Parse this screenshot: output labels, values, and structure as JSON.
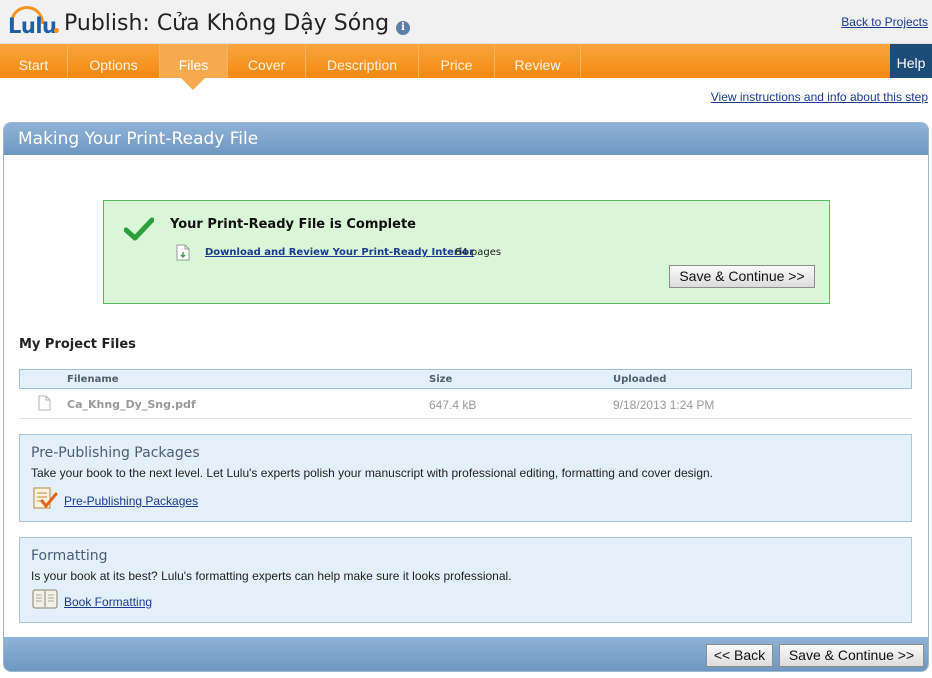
{
  "header": {
    "logo_text": "Lulu",
    "title": "Publish: Cửa Không Dậy Sóng",
    "info_icon": "i",
    "back_link": "Back to Projects"
  },
  "nav": {
    "tabs": [
      {
        "label": "Start"
      },
      {
        "label": "Options"
      },
      {
        "label": "Files"
      },
      {
        "label": "Cover"
      },
      {
        "label": "Description"
      },
      {
        "label": "Price"
      },
      {
        "label": "Review"
      }
    ],
    "active_tab": "Files",
    "help": "Help"
  },
  "instructions_link": "View instructions and info about this step",
  "panel": {
    "title": "Making Your Print-Ready File"
  },
  "success": {
    "title": "Your Print-Ready File is Complete",
    "download_link": "Download and Review Your Print-Ready Interior",
    "pages": "84 pages",
    "save_button": "Save & Continue >>"
  },
  "project_files": {
    "title": "My Project Files",
    "columns": {
      "filename": "Filename",
      "size": "Size",
      "uploaded": "Uploaded"
    },
    "rows": [
      {
        "filename": "Ca_Khng_Dy_Sng.pdf",
        "size": "647.4 kB",
        "uploaded": "9/18/2013 1:24 PM"
      }
    ]
  },
  "promos": [
    {
      "title": "Pre-Publishing Packages",
      "text": "Take your book to the next level. Let Lulu's experts polish your manuscript with professional editing, formatting and cover design.",
      "link": "Pre-Publishing Packages",
      "icon": "checklist-icon"
    },
    {
      "title": "Formatting",
      "text": "Is your book at its best? Lulu's formatting experts can help make sure it looks professional.",
      "link": "Book Formatting",
      "icon": "book-icon"
    }
  ],
  "footer": {
    "back_button": "<< Back",
    "save_button": "Save & Continue >>"
  },
  "colors": {
    "nav_orange": "#f48a12",
    "help_blue": "#1e4c78",
    "panel_blue": "#6f97c1",
    "success_green": "#d9f7d7",
    "link_blue": "#1a3c8e"
  }
}
